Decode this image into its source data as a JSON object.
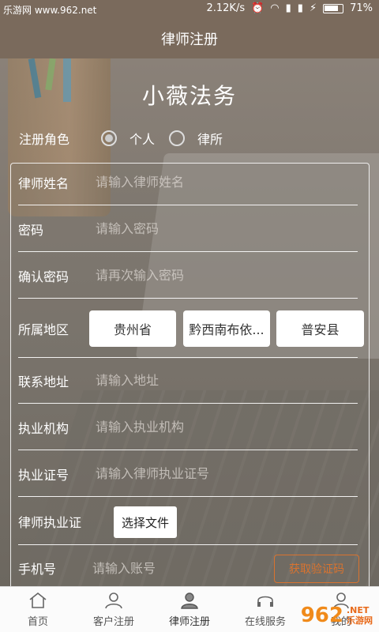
{
  "status_bar": {
    "watermark": "乐游网 www.962.net",
    "net_speed": "2.12K/s",
    "battery_pct": "71%"
  },
  "header": {
    "title": "律师注册"
  },
  "app": {
    "name": "小薇法务"
  },
  "role": {
    "label": "注册角色",
    "options": [
      {
        "label": "个人",
        "checked": true
      },
      {
        "label": "律所",
        "checked": false
      }
    ]
  },
  "form": {
    "name": {
      "label": "律师姓名",
      "placeholder": "请输入律师姓名"
    },
    "password": {
      "label": "密码",
      "placeholder": "请输入密码"
    },
    "confirm_password": {
      "label": "确认密码",
      "placeholder": "请再次输入密码"
    },
    "region": {
      "label": "所属地区",
      "province": "贵州省",
      "prefecture": "黔西南布依...",
      "county": "普安县"
    },
    "address": {
      "label": "联系地址",
      "placeholder": "请输入地址"
    },
    "institution": {
      "label": "执业机构",
      "placeholder": "请输入执业机构"
    },
    "license_no": {
      "label": "执业证号",
      "placeholder": "请输入律师执业证号"
    },
    "license_file": {
      "label": "律师执业证",
      "button": "选择文件"
    },
    "phone": {
      "label": "手机号",
      "placeholder": "请输入账号",
      "code_button": "获取验证码"
    }
  },
  "bottom_nav": {
    "items": [
      {
        "label": "首页",
        "icon": "home-icon"
      },
      {
        "label": "客户注册",
        "icon": "person-icon"
      },
      {
        "label": "律师注册",
        "icon": "lawyer-icon"
      },
      {
        "label": "在线服务",
        "icon": "headset-icon"
      },
      {
        "label": "我的",
        "icon": "profile-icon"
      }
    ]
  },
  "watermark": {
    "logo": "962",
    "line1": ".NET",
    "line2": "乐游网"
  },
  "colors": {
    "header_bg": "#7a6a5c",
    "accent": "#d9732f",
    "nav_bg": "#fbfbfb"
  }
}
